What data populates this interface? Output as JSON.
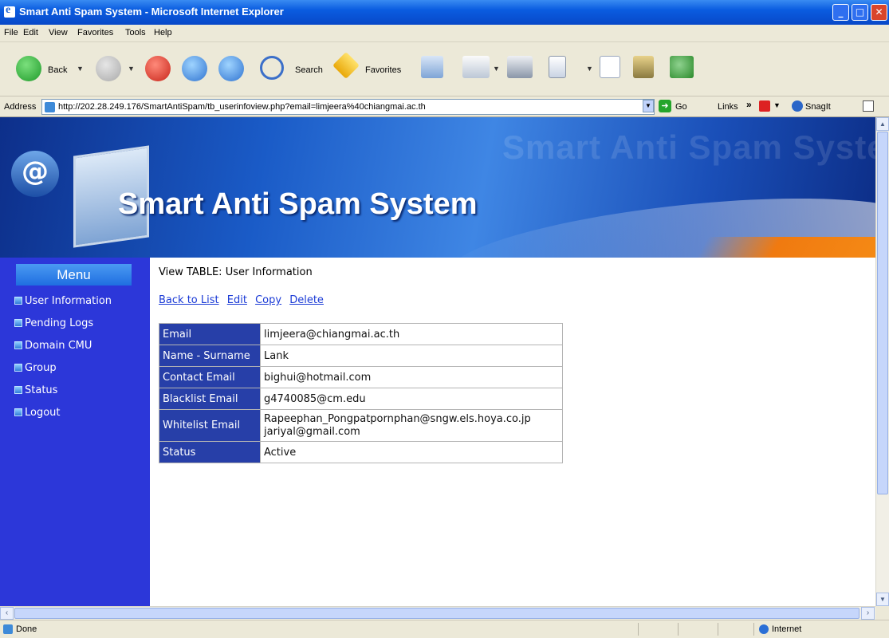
{
  "window": {
    "title": "Smart Anti Spam System - Microsoft Internet Explorer"
  },
  "menubar": [
    "File",
    "Edit",
    "View",
    "Favorites",
    "Tools",
    "Help"
  ],
  "toolbar": {
    "back_label": "Back",
    "search_label": "Search",
    "favorites_label": "Favorites"
  },
  "address": {
    "label": "Address",
    "url": "http://202.28.249.176/SmartAntiSpam/tb_userinfoview.php?email=limjeera%40chiangmai.ac.th",
    "go_label": "Go",
    "links_label": "Links",
    "snagit_label": "SnagIt"
  },
  "banner": {
    "title": "Smart Anti Spam System",
    "watermark": "Smart Anti Spam System",
    "at_symbol": "@"
  },
  "sidebar": {
    "heading": "Menu",
    "items": [
      {
        "label": "User Information"
      },
      {
        "label": "Pending Logs"
      },
      {
        "label": "Domain CMU"
      },
      {
        "label": "Group"
      },
      {
        "label": "Status"
      },
      {
        "label": "Logout"
      }
    ]
  },
  "main": {
    "heading": "View TABLE: User Information",
    "actions": [
      "Back to List",
      "Edit",
      "Copy",
      "Delete"
    ],
    "rows": [
      {
        "key": "Email",
        "value": "limjeera@chiangmai.ac.th"
      },
      {
        "key": "Name - Surname",
        "value": "Lank"
      },
      {
        "key": "Contact Email",
        "value": "bighui@hotmail.com"
      },
      {
        "key": "Blacklist Email",
        "value": "g4740085@cm.edu"
      },
      {
        "key": "Whitelist Email",
        "value_lines": [
          "Rapeephan_Pongpatpornphan@sngw.els.hoya.co.jp",
          "jariyal@gmail.com"
        ]
      },
      {
        "key": "Status",
        "value": "Active"
      }
    ]
  },
  "status": {
    "text": "Done",
    "zone": "Internet"
  },
  "colors": {
    "sidebar_bg": "#2c37d9",
    "table_key_bg": "#273fa8",
    "link": "#1a3ad6"
  }
}
